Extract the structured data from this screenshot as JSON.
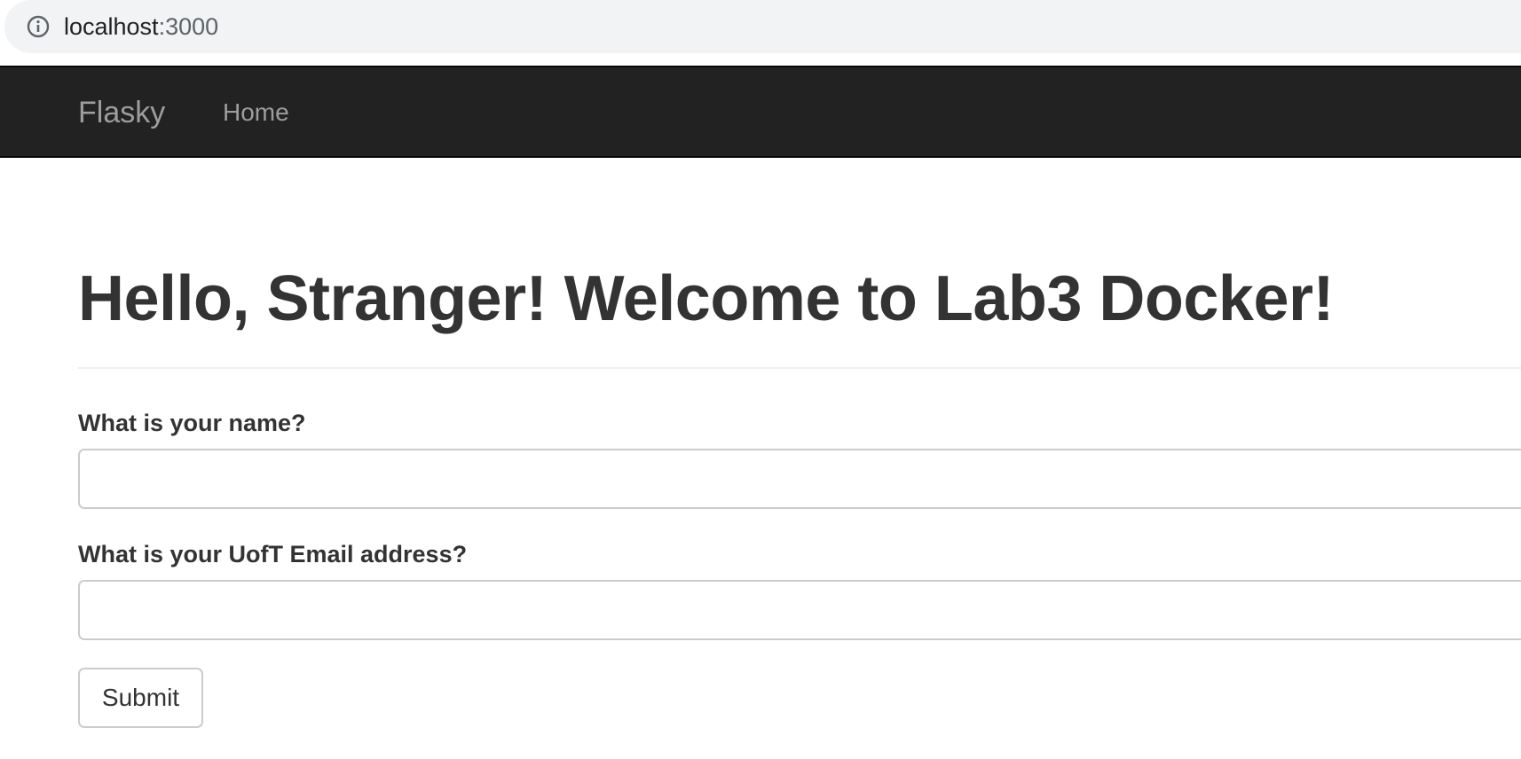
{
  "browser": {
    "url_host": "localhost",
    "url_port": ":3000",
    "icon": "info-icon"
  },
  "navbar": {
    "brand": "Flasky",
    "items": [
      {
        "label": "Home"
      }
    ],
    "background": "#222222",
    "text_color": "#9d9d9d"
  },
  "main": {
    "title": "Hello, Stranger! Welcome to Lab3 Docker!",
    "form": {
      "name_label": "What is your name?",
      "name_value": "",
      "email_label": "What is your UofT Email address?",
      "email_value": "",
      "submit_label": "Submit"
    }
  }
}
